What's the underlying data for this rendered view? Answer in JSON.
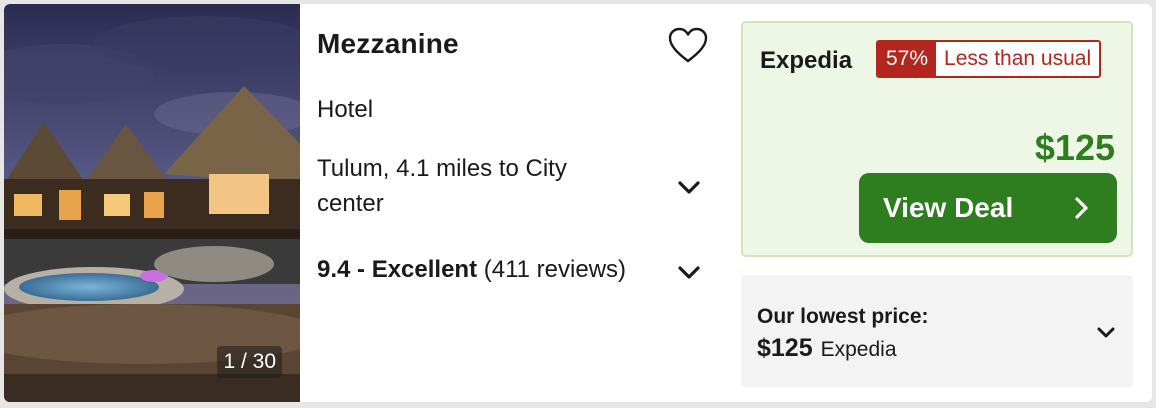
{
  "hotel": {
    "name": "Mezzanine",
    "type": "Hotel",
    "location": "Tulum, 4.1 miles to City center",
    "rating_score": "9.4 - Excellent",
    "review_count": "(411 reviews)"
  },
  "photo": {
    "counter": "1 / 30"
  },
  "deal": {
    "provider": "Expedia",
    "discount_pct": "57%",
    "discount_text": "Less than usual",
    "price": "$125",
    "button_label": "View Deal"
  },
  "lowest": {
    "label": "Our lowest price:",
    "price": "$125",
    "provider": "Expedia"
  },
  "colors": {
    "accent_green": "#2e7d1f",
    "discount_red": "#b3261e",
    "deal_bg": "#eef7e6"
  },
  "icons": {
    "favorite": "heart-outline-icon",
    "expand": "chevron-down-icon",
    "go": "chevron-right-icon"
  }
}
